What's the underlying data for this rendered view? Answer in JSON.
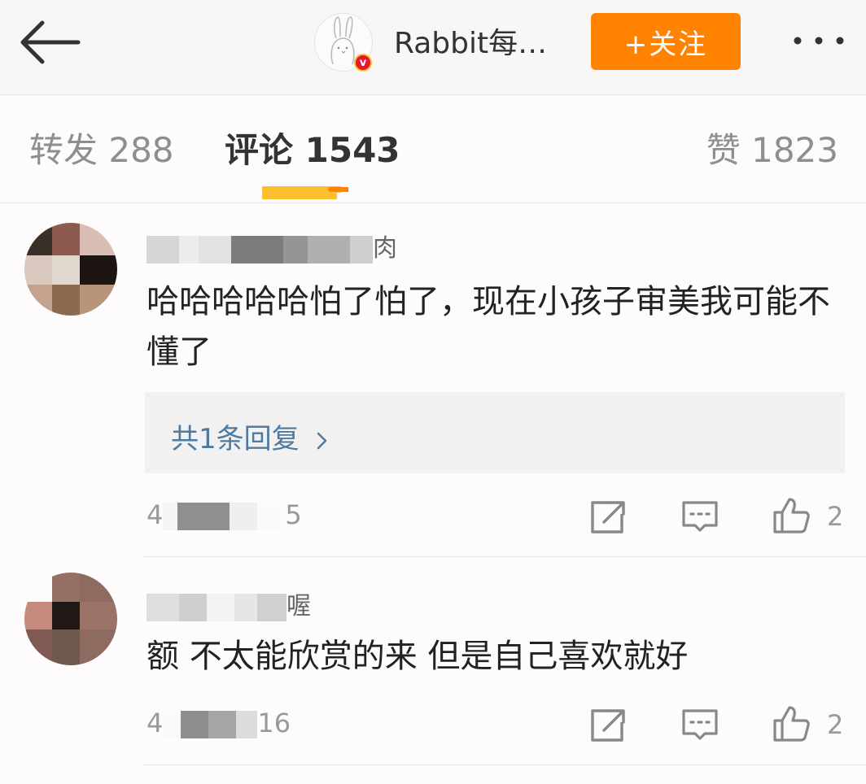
{
  "header": {
    "back_icon": "arrow-left-icon",
    "author_name": "Rabbit每…",
    "verified_badge": "v",
    "follow_label": "+关注",
    "more_icon": "more-dots-icon",
    "accent_color": "#ff8200"
  },
  "tabs": {
    "repost": "转发 288",
    "comments": "评论 1543",
    "likes": "赞 1823",
    "indicator_color": "#fcc02e"
  },
  "comments": [
    {
      "username_visible": "肉",
      "text": "哈哈哈哈哈怕了怕了，现在小孩子审美我可能不懂了",
      "reply_summary": "共1条回复",
      "time_visible_start": "4",
      "time_visible_end": "5",
      "like_count": "2"
    },
    {
      "username_visible": "喔",
      "text": "额 不太能欣赏的来 但是自己喜欢就好",
      "time_visible_start": "4",
      "time_visible_end": "16",
      "like_count": "2"
    }
  ],
  "icons": {
    "repost": "share-icon",
    "comment": "comment-icon",
    "like": "thumbs-up-icon"
  }
}
